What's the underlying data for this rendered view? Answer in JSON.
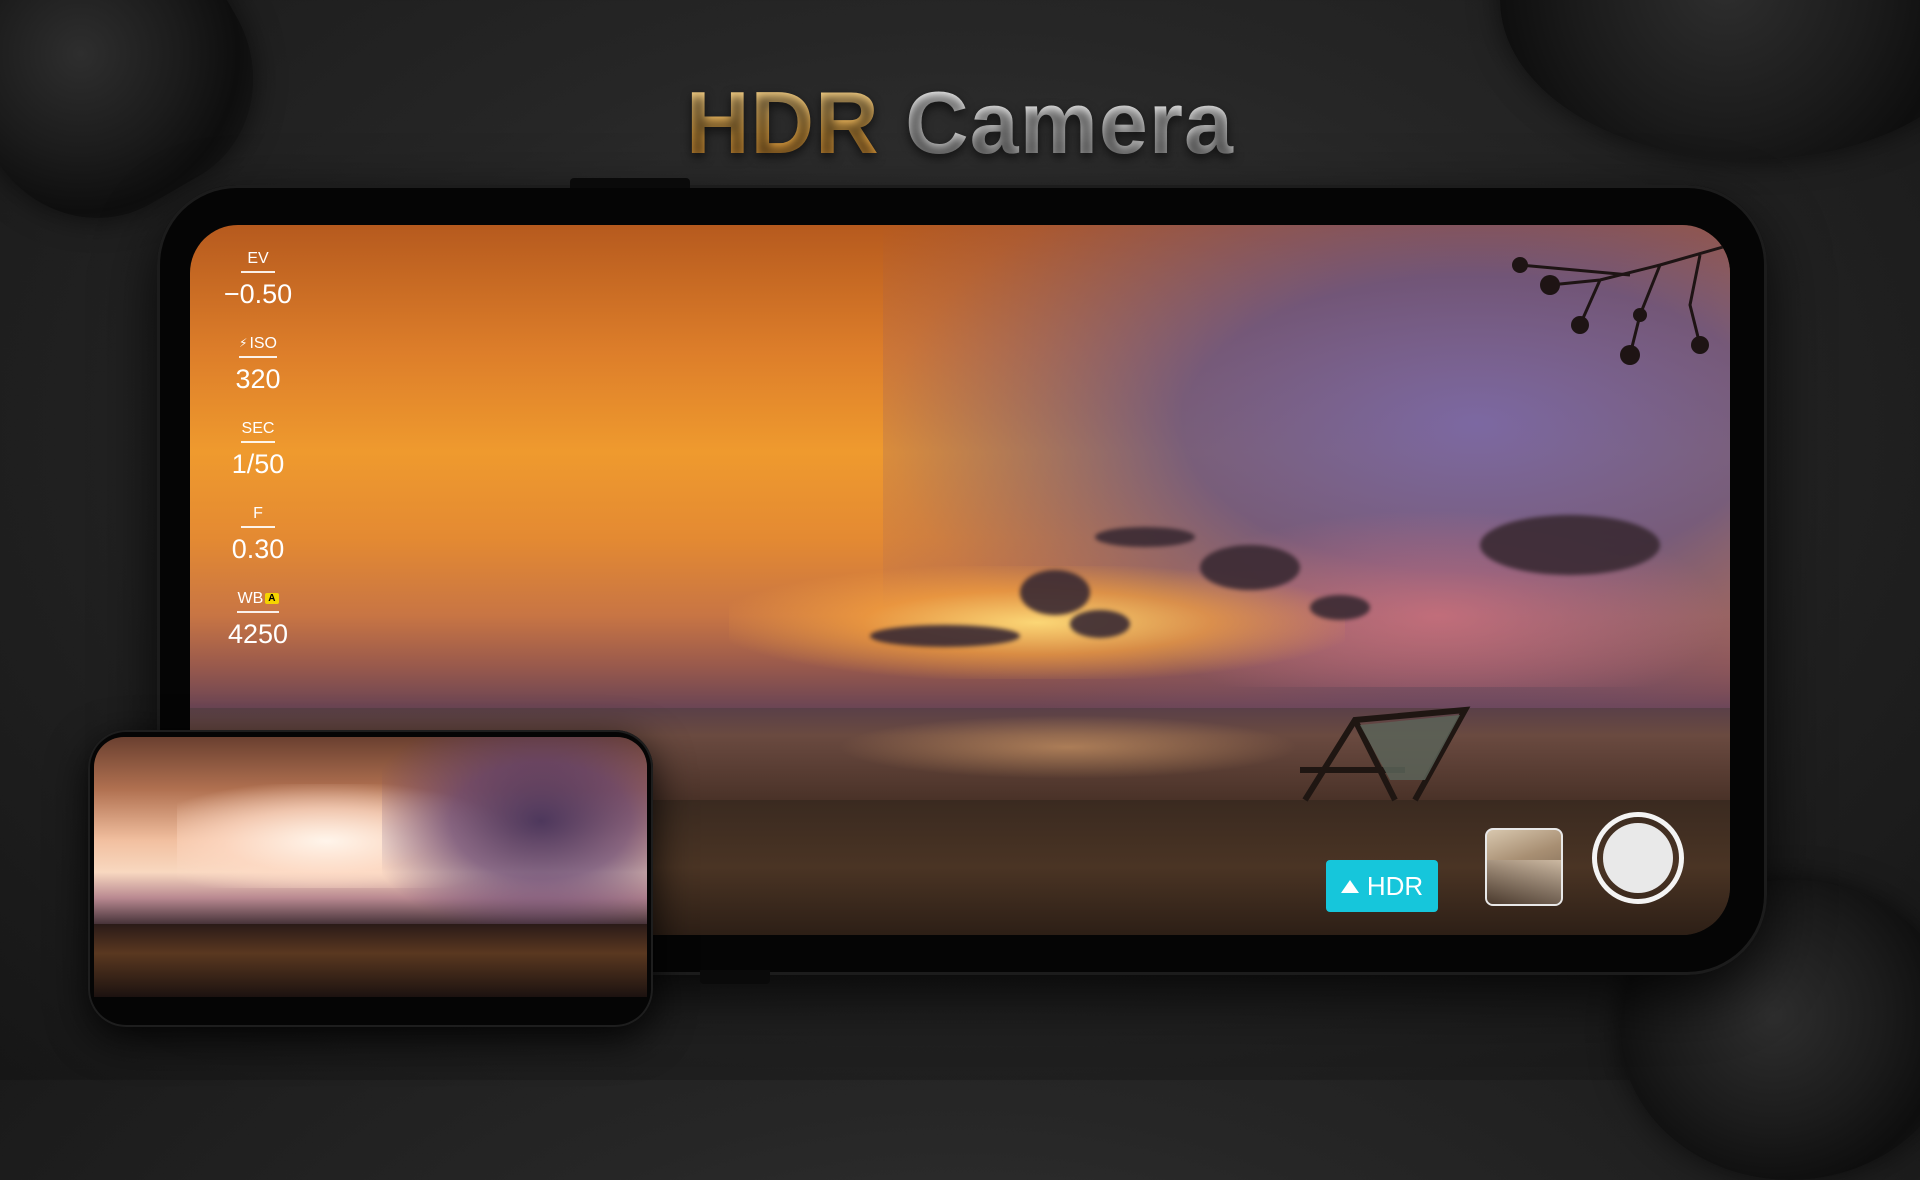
{
  "title": {
    "part1": "HDR",
    "part2": "Camera"
  },
  "params": [
    {
      "label": "EV",
      "value": "−0.50"
    },
    {
      "label": "ISO",
      "value": "320"
    },
    {
      "label": "SEC",
      "value": "1/50"
    },
    {
      "label": "F",
      "value": "0.30"
    },
    {
      "label": "WB",
      "value": "4250",
      "badge": "A"
    }
  ],
  "controls": {
    "hdr_label": "HDR"
  },
  "colors": {
    "hdr_button": "#16c6db",
    "wb_badge": "#f5d400",
    "title_gold": "#f0b04a"
  },
  "icons": {
    "hdr": "triangle-up-icon",
    "iso": "flash-icon"
  }
}
